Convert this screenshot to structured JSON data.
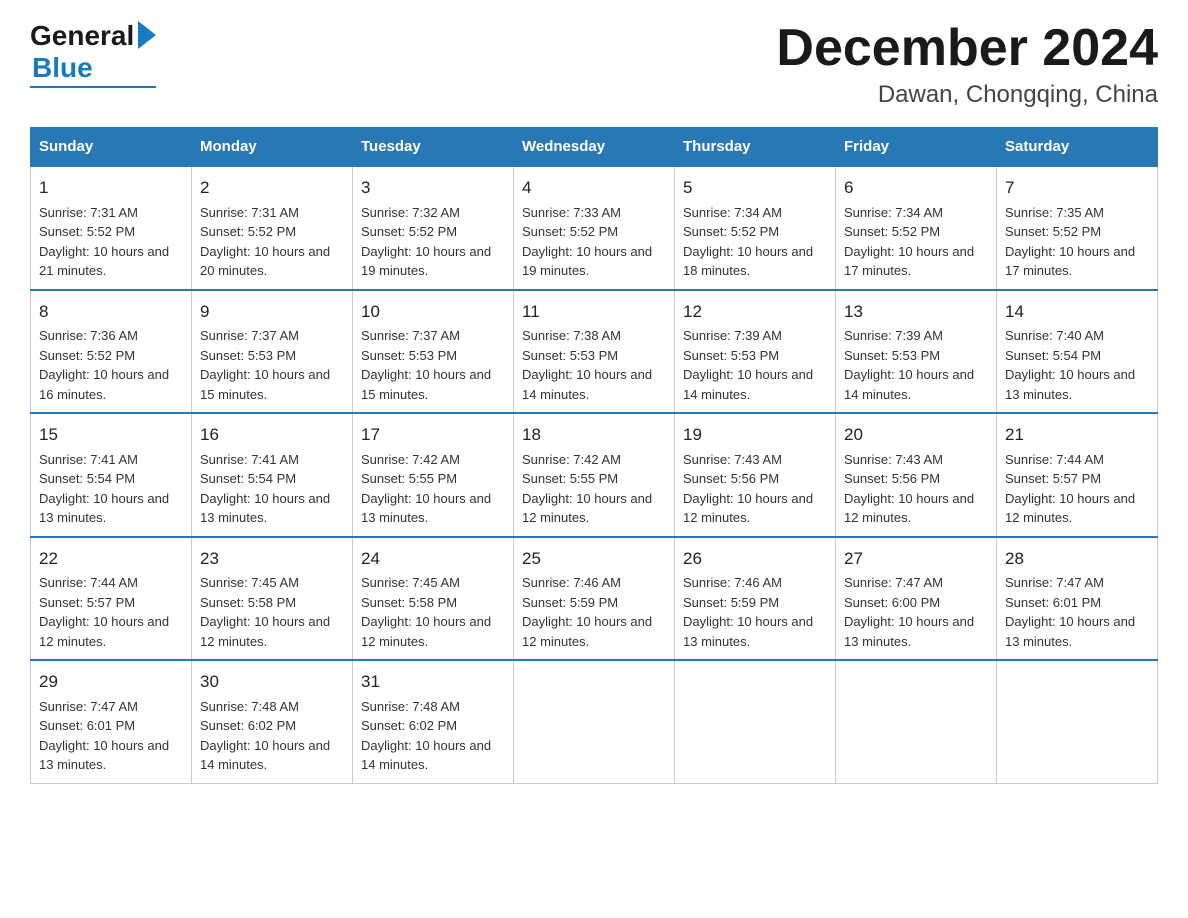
{
  "logo": {
    "general": "General",
    "blue": "Blue"
  },
  "title": "December 2024",
  "subtitle": "Dawan, Chongqing, China",
  "days_of_week": [
    "Sunday",
    "Monday",
    "Tuesday",
    "Wednesday",
    "Thursday",
    "Friday",
    "Saturday"
  ],
  "weeks": [
    [
      {
        "day": "1",
        "sunrise": "7:31 AM",
        "sunset": "5:52 PM",
        "daylight": "10 hours and 21 minutes."
      },
      {
        "day": "2",
        "sunrise": "7:31 AM",
        "sunset": "5:52 PM",
        "daylight": "10 hours and 20 minutes."
      },
      {
        "day": "3",
        "sunrise": "7:32 AM",
        "sunset": "5:52 PM",
        "daylight": "10 hours and 19 minutes."
      },
      {
        "day": "4",
        "sunrise": "7:33 AM",
        "sunset": "5:52 PM",
        "daylight": "10 hours and 19 minutes."
      },
      {
        "day": "5",
        "sunrise": "7:34 AM",
        "sunset": "5:52 PM",
        "daylight": "10 hours and 18 minutes."
      },
      {
        "day": "6",
        "sunrise": "7:34 AM",
        "sunset": "5:52 PM",
        "daylight": "10 hours and 17 minutes."
      },
      {
        "day": "7",
        "sunrise": "7:35 AM",
        "sunset": "5:52 PM",
        "daylight": "10 hours and 17 minutes."
      }
    ],
    [
      {
        "day": "8",
        "sunrise": "7:36 AM",
        "sunset": "5:52 PM",
        "daylight": "10 hours and 16 minutes."
      },
      {
        "day": "9",
        "sunrise": "7:37 AM",
        "sunset": "5:53 PM",
        "daylight": "10 hours and 15 minutes."
      },
      {
        "day": "10",
        "sunrise": "7:37 AM",
        "sunset": "5:53 PM",
        "daylight": "10 hours and 15 minutes."
      },
      {
        "day": "11",
        "sunrise": "7:38 AM",
        "sunset": "5:53 PM",
        "daylight": "10 hours and 14 minutes."
      },
      {
        "day": "12",
        "sunrise": "7:39 AM",
        "sunset": "5:53 PM",
        "daylight": "10 hours and 14 minutes."
      },
      {
        "day": "13",
        "sunrise": "7:39 AM",
        "sunset": "5:53 PM",
        "daylight": "10 hours and 14 minutes."
      },
      {
        "day": "14",
        "sunrise": "7:40 AM",
        "sunset": "5:54 PM",
        "daylight": "10 hours and 13 minutes."
      }
    ],
    [
      {
        "day": "15",
        "sunrise": "7:41 AM",
        "sunset": "5:54 PM",
        "daylight": "10 hours and 13 minutes."
      },
      {
        "day": "16",
        "sunrise": "7:41 AM",
        "sunset": "5:54 PM",
        "daylight": "10 hours and 13 minutes."
      },
      {
        "day": "17",
        "sunrise": "7:42 AM",
        "sunset": "5:55 PM",
        "daylight": "10 hours and 13 minutes."
      },
      {
        "day": "18",
        "sunrise": "7:42 AM",
        "sunset": "5:55 PM",
        "daylight": "10 hours and 12 minutes."
      },
      {
        "day": "19",
        "sunrise": "7:43 AM",
        "sunset": "5:56 PM",
        "daylight": "10 hours and 12 minutes."
      },
      {
        "day": "20",
        "sunrise": "7:43 AM",
        "sunset": "5:56 PM",
        "daylight": "10 hours and 12 minutes."
      },
      {
        "day": "21",
        "sunrise": "7:44 AM",
        "sunset": "5:57 PM",
        "daylight": "10 hours and 12 minutes."
      }
    ],
    [
      {
        "day": "22",
        "sunrise": "7:44 AM",
        "sunset": "5:57 PM",
        "daylight": "10 hours and 12 minutes."
      },
      {
        "day": "23",
        "sunrise": "7:45 AM",
        "sunset": "5:58 PM",
        "daylight": "10 hours and 12 minutes."
      },
      {
        "day": "24",
        "sunrise": "7:45 AM",
        "sunset": "5:58 PM",
        "daylight": "10 hours and 12 minutes."
      },
      {
        "day": "25",
        "sunrise": "7:46 AM",
        "sunset": "5:59 PM",
        "daylight": "10 hours and 12 minutes."
      },
      {
        "day": "26",
        "sunrise": "7:46 AM",
        "sunset": "5:59 PM",
        "daylight": "10 hours and 13 minutes."
      },
      {
        "day": "27",
        "sunrise": "7:47 AM",
        "sunset": "6:00 PM",
        "daylight": "10 hours and 13 minutes."
      },
      {
        "day": "28",
        "sunrise": "7:47 AM",
        "sunset": "6:01 PM",
        "daylight": "10 hours and 13 minutes."
      }
    ],
    [
      {
        "day": "29",
        "sunrise": "7:47 AM",
        "sunset": "6:01 PM",
        "daylight": "10 hours and 13 minutes."
      },
      {
        "day": "30",
        "sunrise": "7:48 AM",
        "sunset": "6:02 PM",
        "daylight": "10 hours and 14 minutes."
      },
      {
        "day": "31",
        "sunrise": "7:48 AM",
        "sunset": "6:02 PM",
        "daylight": "10 hours and 14 minutes."
      },
      null,
      null,
      null,
      null
    ]
  ]
}
